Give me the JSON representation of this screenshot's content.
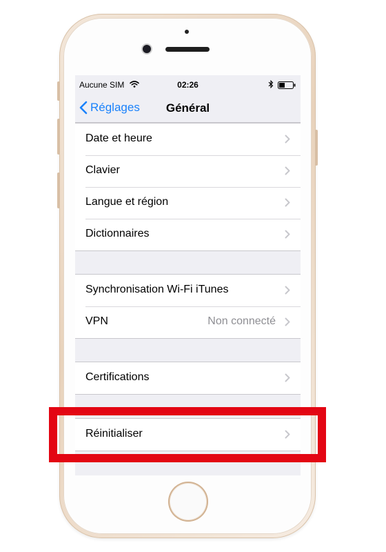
{
  "status_bar": {
    "carrier": "Aucune SIM",
    "time": "02:26"
  },
  "nav": {
    "back_label": "Réglages",
    "title": "Général"
  },
  "groups": [
    {
      "items": [
        {
          "label": "Date et heure",
          "value": ""
        },
        {
          "label": "Clavier",
          "value": ""
        },
        {
          "label": "Langue et région",
          "value": ""
        },
        {
          "label": "Dictionnaires",
          "value": ""
        }
      ]
    },
    {
      "items": [
        {
          "label": "Synchronisation Wi-Fi iTunes",
          "value": ""
        },
        {
          "label": "VPN",
          "value": "Non connecté"
        }
      ]
    },
    {
      "items": [
        {
          "label": "Certifications",
          "value": ""
        }
      ]
    },
    {
      "items": [
        {
          "label": "Réinitialiser",
          "value": ""
        }
      ]
    }
  ],
  "colors": {
    "accent": "#1a82fb",
    "highlight": "#e30613",
    "background": "#efeff4"
  },
  "icons": [
    "wifi-icon",
    "bluetooth-icon",
    "battery-icon",
    "chevron-back-icon",
    "chevron-right-icon"
  ]
}
